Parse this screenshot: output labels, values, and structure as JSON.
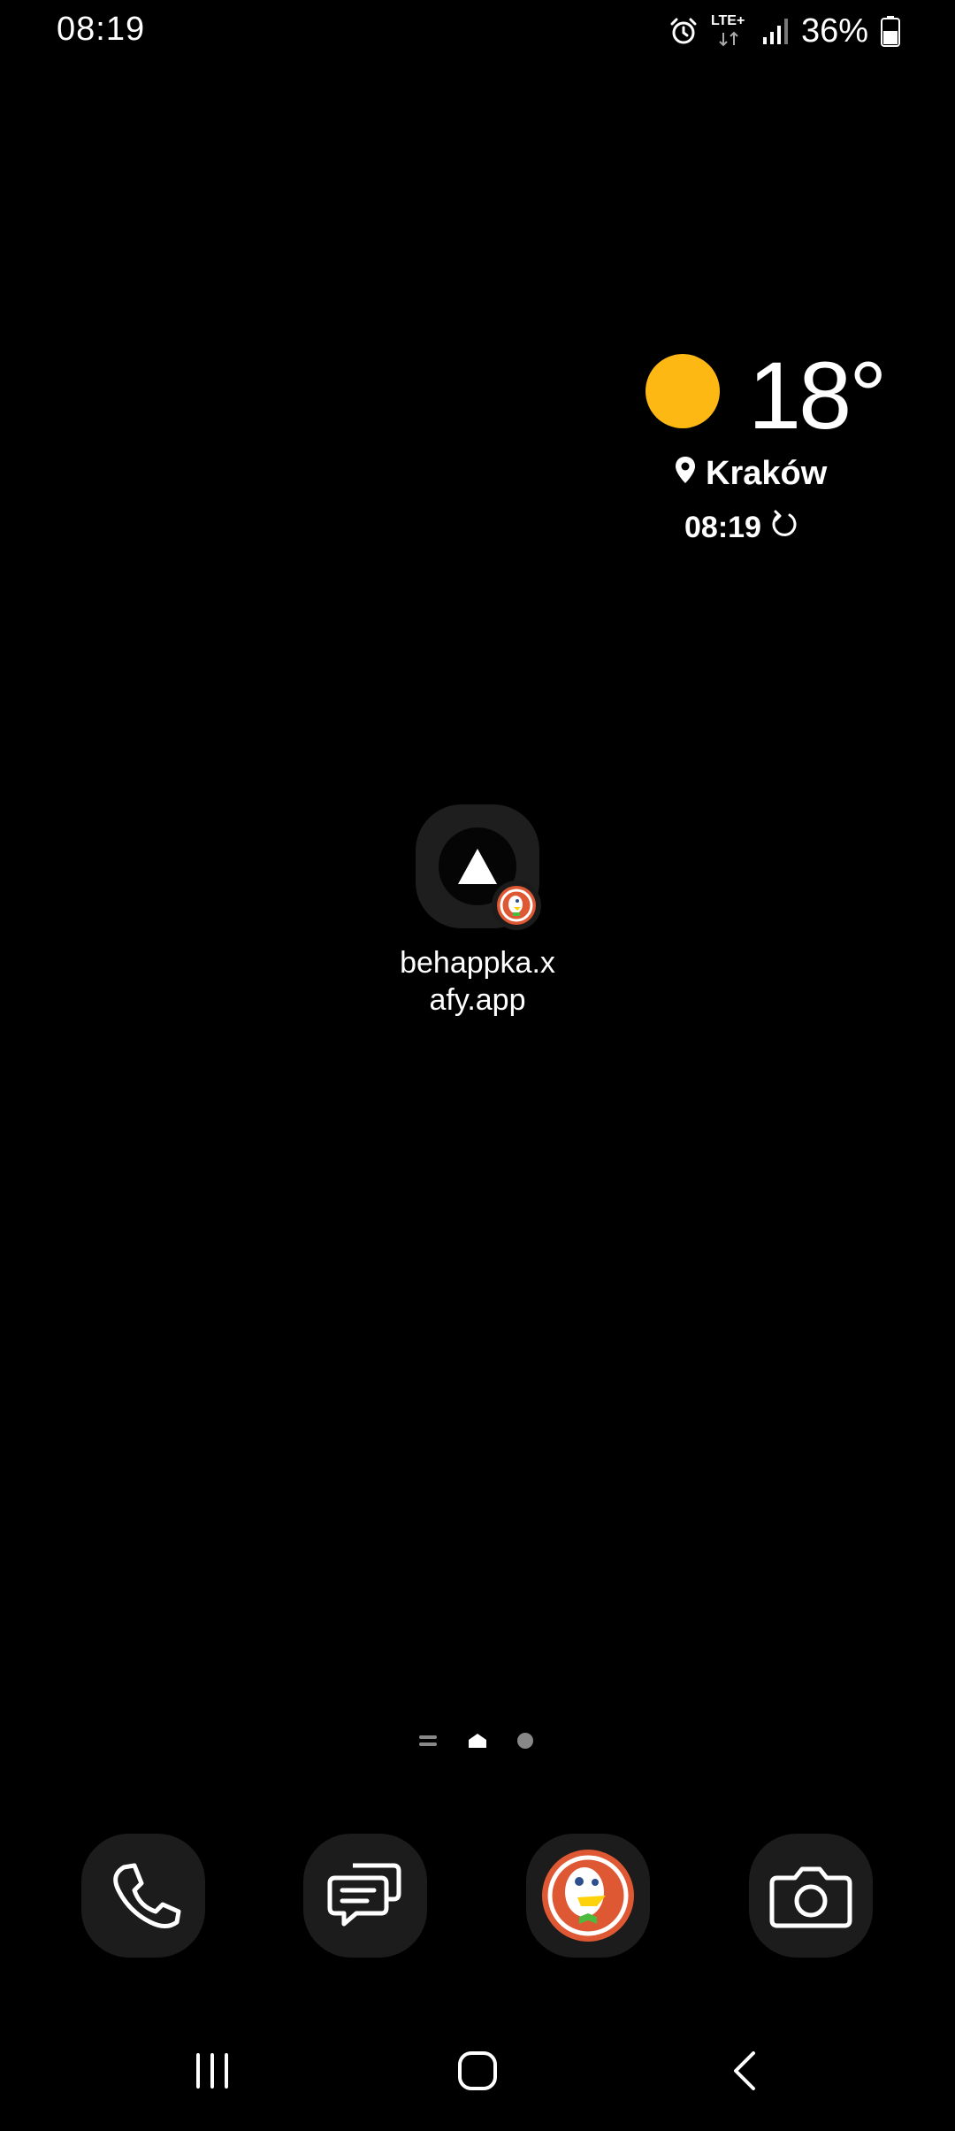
{
  "status_bar": {
    "time": "08:19",
    "network": "LTE+",
    "battery_percent": "36%",
    "icons": [
      "alarm-icon",
      "lte-icon",
      "signal-icon",
      "battery-icon"
    ]
  },
  "weather": {
    "temperature": "18°",
    "location": "Kraków",
    "updated_time": "08:19",
    "condition_icon": "sun-icon",
    "sun_color": "#FDB813"
  },
  "home": {
    "shortcut_label": "behappka.x\nafy.app"
  },
  "page_indicators": {
    "pages": [
      "menu",
      "home",
      "page"
    ],
    "active": "home"
  },
  "dock": {
    "apps": [
      "phone-icon",
      "messages-icon",
      "duckduckgo-icon",
      "camera-icon"
    ],
    "duckduckgo_color": "#DE5833"
  },
  "nav_bar": {
    "buttons": [
      "recent-apps",
      "home",
      "back"
    ]
  }
}
